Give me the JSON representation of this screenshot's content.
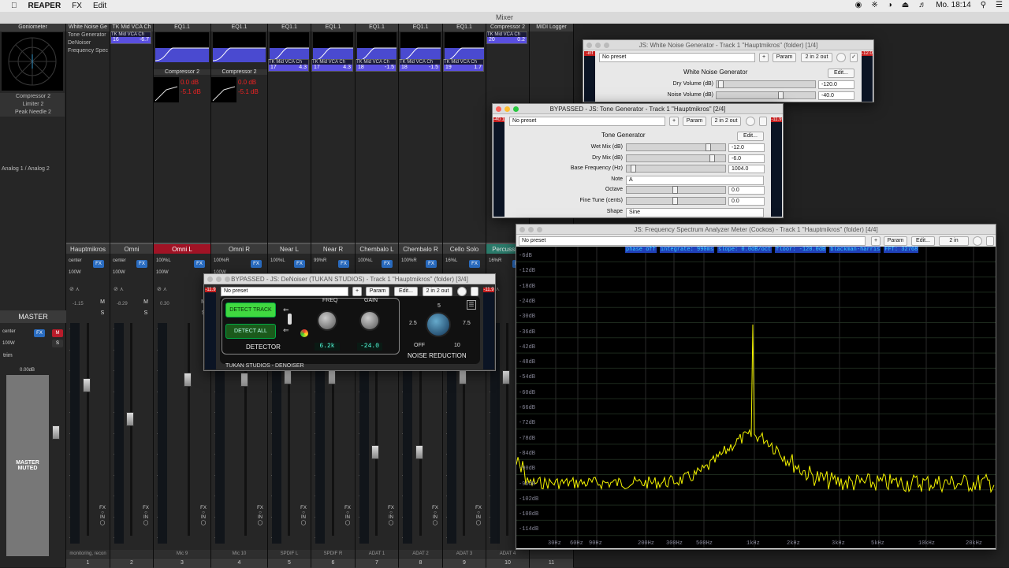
{
  "menubar": {
    "app": "REAPER",
    "fx": "FX",
    "edit": "Edit",
    "clock": "Mo. 18:14"
  },
  "mixer_title": "Mixer",
  "sidebar": {
    "goniometer": "Goniometer",
    "slots": [
      "Compressor 2",
      "Limiter 2",
      "Peak Needle 2"
    ],
    "io": "Analog 1 / Analog 2",
    "master": "MASTER",
    "pan": "center",
    "vol": "100W",
    "fx": "FX",
    "m": "M",
    "s": "S",
    "trim": "trim",
    "peak": "0.00dB",
    "muted": "MASTER\nMUTED"
  },
  "tracks": [
    {
      "name": "Hauptmikros",
      "fx_slots": [
        "White Noise Ge",
        "Tone Generator",
        "DeNoiser",
        "Frequency Spec"
      ],
      "pan": "center",
      "vol": "100W",
      "peak": "-1.15",
      "bottom": "monitoring, recon",
      "num": "1"
    },
    {
      "name": "Omni",
      "fx_slots": [
        "TK Mid VCA Ch"
      ],
      "vca_name": "TK Mid VCA Ch",
      "vca": [
        "16",
        "-6.7"
      ],
      "pan": "center",
      "vol": "100W",
      "peak": "-8.29",
      "bottom": "",
      "num": "2"
    },
    {
      "name": "Omni L",
      "fx_slots": [
        "EQ1.1",
        "Compressor 2"
      ],
      "comp": [
        "0.0 dB",
        "-5.1 dB"
      ],
      "pan": "100%L",
      "vol": "100W",
      "peak": "0.30",
      "bottom": "Mic 9",
      "num": "3"
    },
    {
      "name": "Omni R",
      "fx_slots": [
        "EQ1.1",
        "Compressor 2"
      ],
      "comp": [
        "0.0 dB",
        "-5.1 dB"
      ],
      "pan": "100%R",
      "vol": "100W",
      "peak": "",
      "bottom": "Mic 10",
      "num": "4"
    },
    {
      "name": "Near L",
      "fx_slots": [
        "EQ1.1"
      ],
      "vca_name": "TK Mid VCA Ch",
      "vca": [
        "17",
        "4.3"
      ],
      "pan": "100%L",
      "vol": "",
      "peak": "",
      "bottom": "SPDIF L",
      "num": "5"
    },
    {
      "name": "Near R",
      "fx_slots": [
        "EQ1.1"
      ],
      "vca_name": "TK Mid VCA Ch",
      "vca": [
        "17",
        "4.3"
      ],
      "pan": "99%R",
      "vol": "",
      "peak": "",
      "bottom": "SPDIF R",
      "num": "6"
    },
    {
      "name": "Chembalo L",
      "fx_slots": [
        "EQ1.1"
      ],
      "vca_name": "TK Mid VCA Ch",
      "vca": [
        "18",
        "-1.5"
      ],
      "pan": "100%L",
      "vol": "",
      "peak": "",
      "bottom": "ADAT 1",
      "num": "7"
    },
    {
      "name": "Chembalo R",
      "fx_slots": [
        "EQ1.1"
      ],
      "vca_name": "TK Mid VCA Ch",
      "vca": [
        "18",
        "-1.5"
      ],
      "pan": "100%R",
      "vol": "",
      "peak": "",
      "bottom": "ADAT 2",
      "num": "8"
    },
    {
      "name": "Cello Solo",
      "fx_slots": [
        "EQ1.1"
      ],
      "vca_name": "TK Mid VCA Ch",
      "vca": [
        "19",
        "1.7"
      ],
      "pan": "16%L",
      "vol": "",
      "peak": "",
      "bottom": "ADAT 3",
      "num": "9"
    },
    {
      "name": "Percussion",
      "fx_slots": [
        "Compressor 2"
      ],
      "vca_name": "TK Mid VCA Ch",
      "vca": [
        "20",
        "0.2"
      ],
      "pan": "16%R",
      "vol": "",
      "peak": "",
      "bottom": "ADAT 4",
      "num": "10"
    },
    {
      "name": "",
      "fx_slots": [
        "MIDI Logger"
      ],
      "pan": "",
      "vol": "",
      "peak": "",
      "bottom": "",
      "num": "11"
    }
  ],
  "meter_ticks": [
    "-0-",
    "-6-",
    "-12-",
    "-18-",
    "-24-",
    "-30-",
    "-36-",
    "-42-",
    "-48-",
    "-54-",
    "-60-"
  ],
  "white_noise": {
    "title": "JS: White Noise Generator - Track 1 \"Hauptmikros\" (folder) [1/4]",
    "preset": "No preset",
    "plus": "+",
    "param": "Param",
    "io": "2 in 2 out",
    "edit": "Edit...",
    "name": "White Noise Generator",
    "params": [
      {
        "label": "Dry Volume (dB)",
        "value": "-120.0"
      },
      {
        "label": "Noise Volume (dB)",
        "value": "-40.0"
      }
    ],
    "meter_in": "-inf",
    "meter_out": "-12.0",
    "ticks": [
      "-6-",
      "-18-",
      "-30-",
      "-42-",
      "-54-"
    ]
  },
  "tone": {
    "title": "BYPASSED - JS: Tone Generator - Track 1 \"Hauptmikros\" [2/4]",
    "preset": "No preset",
    "plus": "+",
    "param": "Param",
    "io": "2 in 2 out",
    "edit": "Edit...",
    "name": "Tone Generator",
    "params": [
      {
        "label": "Wet Mix (dB)",
        "value": "-12.0"
      },
      {
        "label": "Dry Mix (dB)",
        "value": "-6.0"
      },
      {
        "label": "Base Frequency (Hz)",
        "value": "1004.0"
      },
      {
        "label": "Note",
        "value": "A"
      },
      {
        "label": "Octave",
        "value": "0.0"
      },
      {
        "label": "Fine Tune (cents)",
        "value": "0.0"
      },
      {
        "label": "Shape",
        "value": "Sine"
      }
    ],
    "meter_in": "-40.1",
    "meter_out": "-11.9",
    "ticks": [
      "-6-",
      "-18-",
      "-30-",
      "-42-",
      "-54-"
    ]
  },
  "denoiser": {
    "title": "BYPASSED - JS: DeNoiser (TUKAN STUDIOS) - Track 1 \"Hauptmikros\" (folder) [3/4]",
    "preset": "No preset",
    "plus": "+",
    "param": "Param",
    "edit": "Edit...",
    "io": "2 in 2 out",
    "detect_track": "DETECT TRACK",
    "detect_all": "DETECT ALL",
    "detector": "DETECTOR",
    "freq": "FREQ",
    "gain": "GAIN",
    "freq_val": "6.2k",
    "gain_val": "-24.0",
    "nr_label": "NOISE REDUCTION",
    "nr_scale": [
      "5",
      "2.5",
      "7.5",
      "OFF",
      "10"
    ],
    "brand": "TUKAN STUDIOS - DENOISER",
    "meter_in": "-11.9",
    "meter_out": "-11.9",
    "ticks": [
      "-6-",
      "-18-",
      "-30-",
      "-42-",
      "-54-"
    ]
  },
  "spectrum": {
    "title": "JS: Frequency Spectrum Analyzer Meter (Cockos) - Track 1 \"Hauptmikros\" (folder) [4/4]",
    "preset": "No preset",
    "plus": "+",
    "param": "Param",
    "edit": "Edit...",
    "io": "2 in",
    "status": [
      "phase off",
      "integrate: 990ms",
      "slope: 0.0dB/oct",
      "floor: -120.0dB",
      "blackman-harris",
      "FFT: 32768"
    ],
    "db_labels": [
      "-6dB",
      "-12dB",
      "-18dB",
      "-24dB",
      "-30dB",
      "-36dB",
      "-42dB",
      "-48dB",
      "-54dB",
      "-60dB",
      "-66dB",
      "-72dB",
      "-78dB",
      "-84dB",
      "-90dB",
      "-96dB",
      "-102dB",
      "-108dB",
      "-114dB"
    ],
    "hz_labels": [
      "30Hz",
      "60Hz",
      "90Hz",
      "200Hz",
      "300Hz",
      "500Hz",
      "1kHz",
      "2kHz",
      "3kHz",
      "5kHz",
      "10kHz",
      "20kHz"
    ],
    "trace_color": "#f4f400"
  }
}
